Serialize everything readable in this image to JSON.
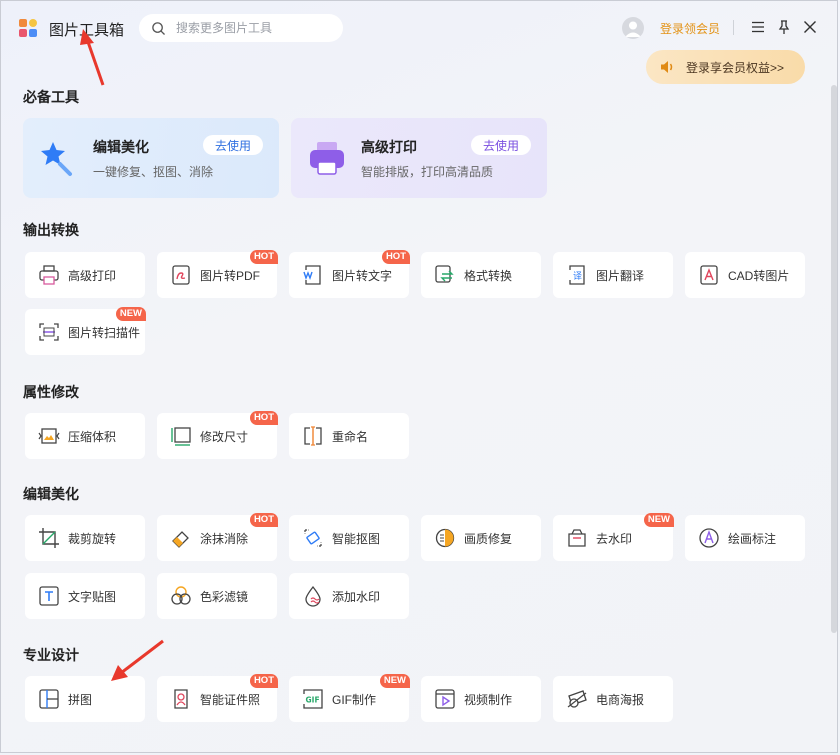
{
  "header": {
    "title": "图片工具箱",
    "search_placeholder": "搜索更多图片工具",
    "login_link": "登录领会员",
    "vip_button": "登录享会员权益>>"
  },
  "sections": {
    "essential": "必备工具",
    "output": "输出转换",
    "attribute": "属性修改",
    "edit": "编辑美化",
    "pro": "专业设计"
  },
  "featured": [
    {
      "title": "编辑美化",
      "desc": "一键修复、抠图、消除",
      "button": "去使用"
    },
    {
      "title": "高级打印",
      "desc": "智能排版，打印高清品质",
      "button": "去使用"
    }
  ],
  "tools": {
    "output": [
      {
        "label": "高级打印",
        "badge": ""
      },
      {
        "label": "图片转PDF",
        "badge": "HOT"
      },
      {
        "label": "图片转文字",
        "badge": "HOT"
      },
      {
        "label": "格式转换",
        "badge": ""
      },
      {
        "label": "图片翻译",
        "badge": ""
      },
      {
        "label": "CAD转图片",
        "badge": ""
      },
      {
        "label": "图片转扫描件",
        "badge": "NEW"
      }
    ],
    "attribute": [
      {
        "label": "压缩体积",
        "badge": ""
      },
      {
        "label": "修改尺寸",
        "badge": "HOT"
      },
      {
        "label": "重命名",
        "badge": ""
      }
    ],
    "edit": [
      {
        "label": "裁剪旋转",
        "badge": ""
      },
      {
        "label": "涂抹消除",
        "badge": "HOT"
      },
      {
        "label": "智能抠图",
        "badge": ""
      },
      {
        "label": "画质修复",
        "badge": ""
      },
      {
        "label": "去水印",
        "badge": "NEW"
      },
      {
        "label": "绘画标注",
        "badge": ""
      },
      {
        "label": "文字贴图",
        "badge": ""
      },
      {
        "label": "色彩滤镜",
        "badge": ""
      },
      {
        "label": "添加水印",
        "badge": ""
      }
    ],
    "pro": [
      {
        "label": "拼图",
        "badge": ""
      },
      {
        "label": "智能证件照",
        "badge": "HOT"
      },
      {
        "label": "GIF制作",
        "badge": "NEW"
      },
      {
        "label": "视频制作",
        "badge": ""
      },
      {
        "label": "电商海报",
        "badge": ""
      }
    ]
  },
  "colors": {
    "accent_orange": "#e39215",
    "badge_red": "#f5654a",
    "annotation_arrow": "#e8382c",
    "featured_blue": "#e2eefc",
    "featured_purple": "#ebe8fb"
  }
}
